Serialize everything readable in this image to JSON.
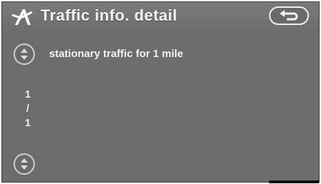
{
  "header": {
    "title": "Traffic info. detail",
    "title_icon": "traffic-icon",
    "back_icon": "return-arrow-icon"
  },
  "detail": {
    "message": "stationary traffic for 1 mile"
  },
  "pagination": {
    "current": "1",
    "separator": "/",
    "total": "1"
  },
  "scroll": {
    "up_icon": "scroll-up-down-icon",
    "down_icon": "scroll-up-down-icon"
  },
  "colors": {
    "background": "#6c6c6c",
    "text": "#f2f2f2"
  }
}
